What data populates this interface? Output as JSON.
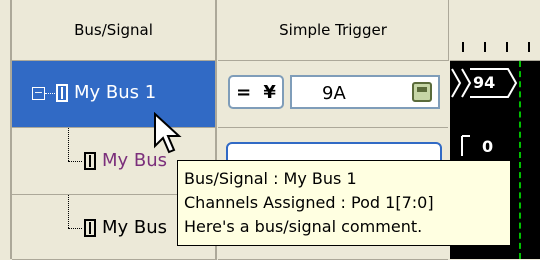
{
  "headers": {
    "bus_signal": "Bus/Signal",
    "simple_trigger": "Simple Trigger"
  },
  "rows": [
    {
      "label": "My Bus 1",
      "toggle": "−"
    },
    {
      "label": "My Bus"
    },
    {
      "label": "My Bus"
    }
  ],
  "trigger": {
    "operator": "=",
    "value": "9A"
  },
  "waveform": {
    "value_1": "94",
    "value_2": "0"
  },
  "tooltip": {
    "line1": "Bus/Signal : My Bus 1",
    "line2": "Channels Assigned : Pod 1[7:0]",
    "line3": "Here's a bus/signal comment."
  },
  "colors": {
    "selected_row": "#316ac5",
    "tooltip_bg": "#ffffe1",
    "cursor_line": "#00c000"
  }
}
